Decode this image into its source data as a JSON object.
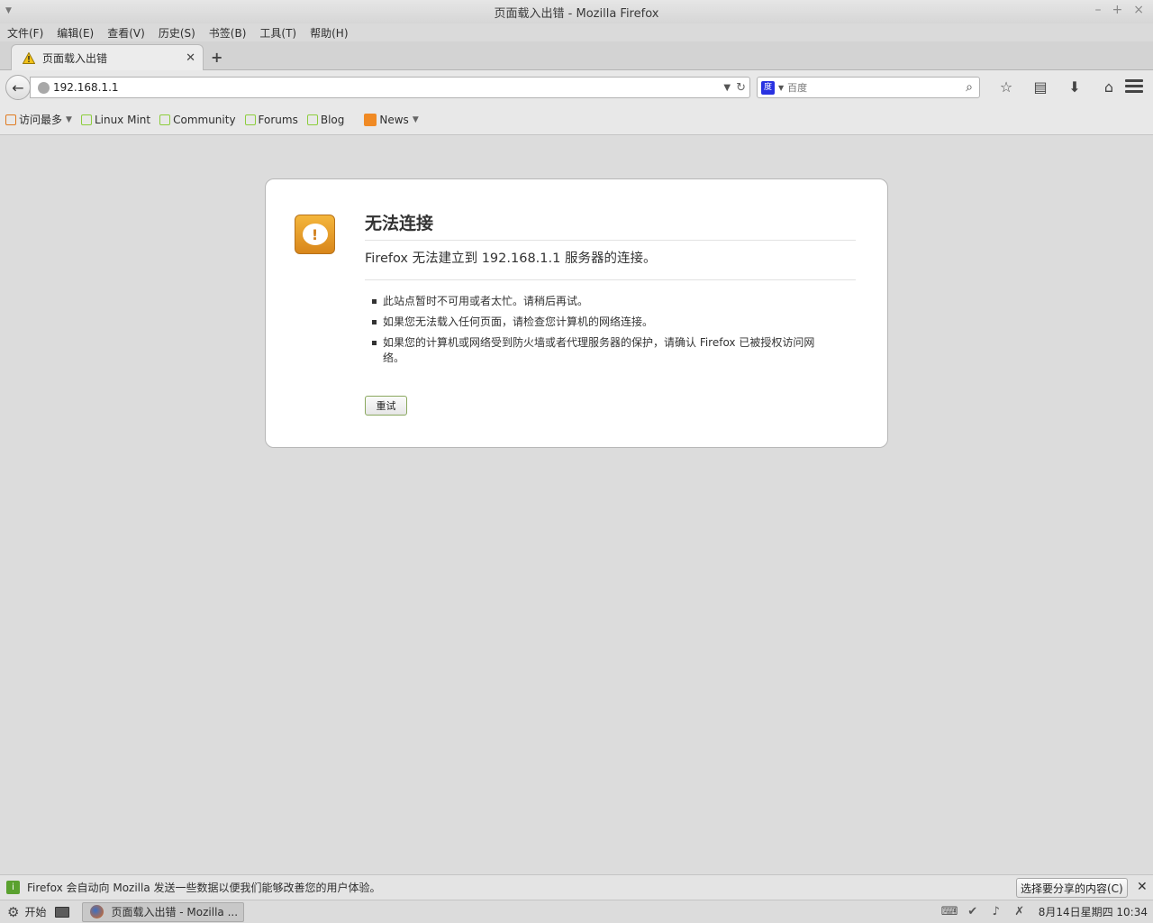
{
  "window": {
    "title": "页面载入出错 - Mozilla Firefox",
    "controls": [
      "–",
      "+",
      "×"
    ]
  },
  "menubar": {
    "items": [
      "文件(F)",
      "编辑(E)",
      "查看(V)",
      "历史(S)",
      "书签(B)",
      "工具(T)",
      "帮助(H)"
    ]
  },
  "tabs": {
    "active_label": "页面载入出错",
    "new_tab_glyph": "+"
  },
  "navbar": {
    "url": "192.168.1.1",
    "search_placeholder": "百度",
    "search_engine_icon": "baidu-paw-icon"
  },
  "bookmarks": {
    "items": [
      {
        "label": "访问最多",
        "icon": "most-visited-icon",
        "dropdown": true
      },
      {
        "label": "Linux Mint",
        "icon": "mint-icon"
      },
      {
        "label": "Community",
        "icon": "mint-icon"
      },
      {
        "label": "Forums",
        "icon": "mint-icon"
      },
      {
        "label": "Blog",
        "icon": "mint-icon"
      },
      {
        "label": "News",
        "icon": "rss-icon",
        "dropdown": true
      }
    ]
  },
  "error": {
    "title": "无法连接",
    "description": "Firefox 无法建立到 192.168.1.1 服务器的连接。",
    "bullets": [
      "此站点暂时不可用或者太忙。请稍后再试。",
      "如果您无法载入任何页面，请检查您计算机的网络连接。",
      "如果您的计算机或网络受到防火墙或者代理服务器的保护，请确认 Firefox 已被授权访问网络。"
    ],
    "retry_label": "重试"
  },
  "notification": {
    "text": "Firefox 会自动向 Mozilla 发送一些数据以便我们能够改善您的用户体验。",
    "button_label": "选择要分享的内容(C)"
  },
  "taskbar": {
    "start_label": "开始",
    "task_label": "页面载入出错 - Mozilla ...",
    "clock": "8月14日星期四 10:34"
  },
  "colors": {
    "accent_orange": "#e08a1e",
    "mint_green": "#8ccd3c",
    "background": "#dcdcdc"
  }
}
